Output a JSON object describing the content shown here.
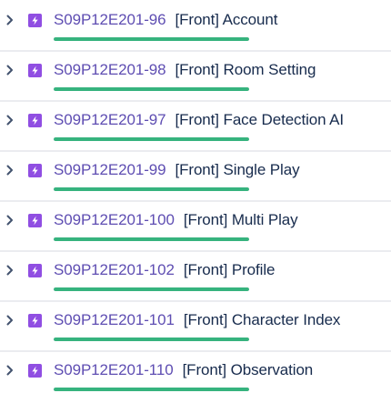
{
  "colors": {
    "epic_icon": "#904ee2",
    "progress_done": "#36b37e",
    "issue_key": "#5e4db2",
    "divider": "#ebecf0"
  },
  "issues": [
    {
      "key": "S09P12E201-96",
      "summary": "[Front] Account",
      "icon": "epic-lightning-icon",
      "progress": 1.0
    },
    {
      "key": "S09P12E201-98",
      "summary": "[Front] Room Setting",
      "icon": "epic-lightning-icon",
      "progress": 1.0
    },
    {
      "key": "S09P12E201-97",
      "summary": "[Front] Face Detection AI",
      "icon": "epic-lightning-icon",
      "progress": 1.0
    },
    {
      "key": "S09P12E201-99",
      "summary": "[Front] Single Play",
      "icon": "epic-lightning-icon",
      "progress": 1.0
    },
    {
      "key": "S09P12E201-100",
      "summary": "[Front] Multi Play",
      "icon": "epic-lightning-icon",
      "progress": 1.0
    },
    {
      "key": "S09P12E201-102",
      "summary": "[Front] Profile",
      "icon": "epic-lightning-icon",
      "progress": 1.0
    },
    {
      "key": "S09P12E201-101",
      "summary": "[Front] Character Index",
      "icon": "epic-lightning-icon",
      "progress": 1.0
    },
    {
      "key": "S09P12E201-110",
      "summary": "[Front] Observation",
      "icon": "epic-lightning-icon",
      "progress": 1.0
    }
  ]
}
